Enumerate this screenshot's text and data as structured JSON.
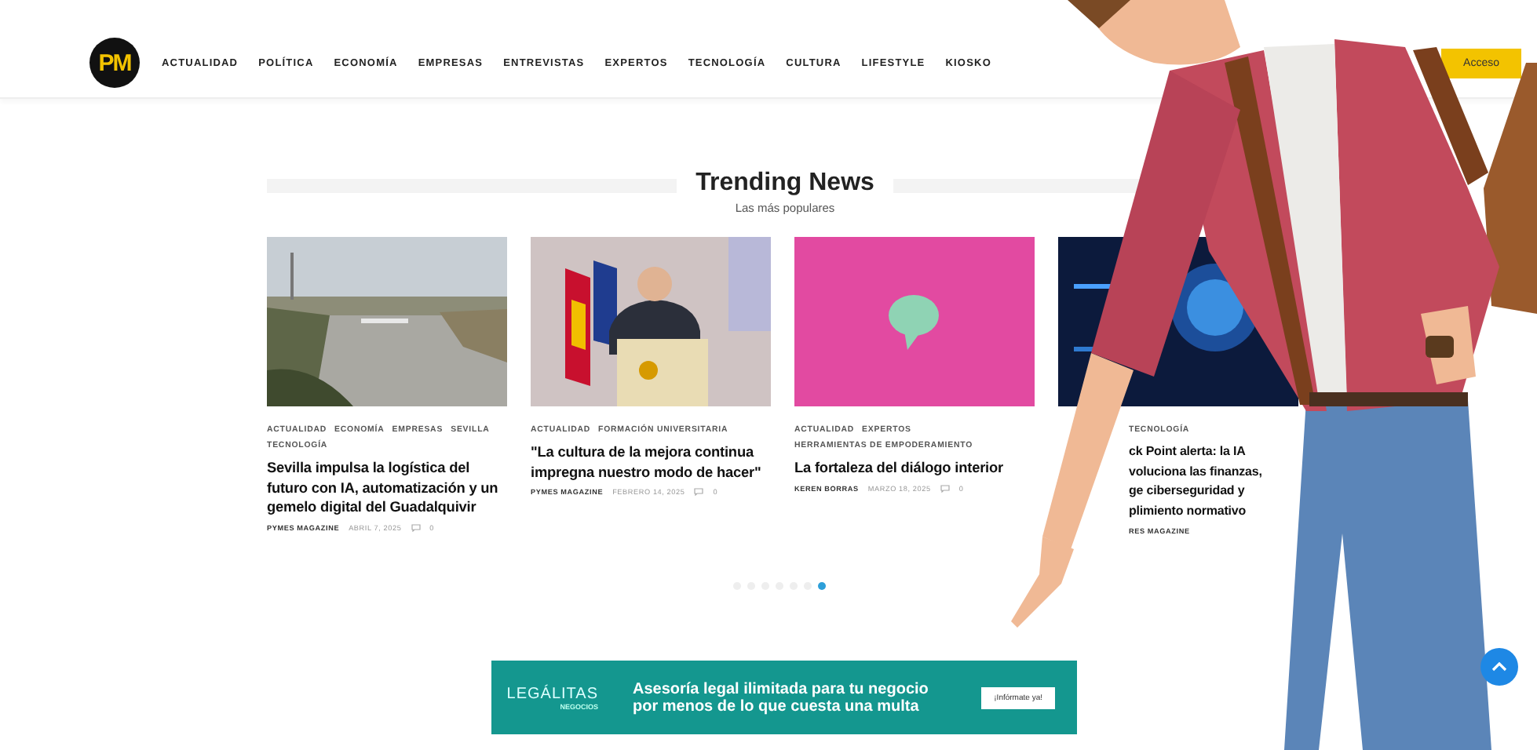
{
  "header": {
    "logo": "PM",
    "nav": [
      {
        "label": "ACTUALIDAD"
      },
      {
        "label": "POLÍTICA"
      },
      {
        "label": "ECONOMÍA"
      },
      {
        "label": "EMPRESAS"
      },
      {
        "label": "ENTREVISTAS"
      },
      {
        "label": "EXPERTOS"
      },
      {
        "label": "TECNOLOGÍA"
      },
      {
        "label": "CULTURA"
      },
      {
        "label": "LIFESTYLE"
      },
      {
        "label": "KIOSKO"
      }
    ],
    "button": "Acceso"
  },
  "section": {
    "title": "Trending News",
    "subtitle": "Las más populares"
  },
  "cards": [
    {
      "tags": [
        "ACTUALIDAD",
        "ECONOMÍA",
        "EMPRESAS",
        "SEVILLA",
        "TECNOLOGÍA"
      ],
      "title": "Sevilla impulsa la logística del futuro con IA, automatización y un gemelo digital del Guadalquivir",
      "author": "PYMES MAGAZINE",
      "date": "ABRIL 7, 2025",
      "comments": "0"
    },
    {
      "tags": [
        "ACTUALIDAD",
        "FORMACIÓN UNIVERSITARIA"
      ],
      "title": "\"La cultura de la mejora continua impregna nuestro modo de hacer\"",
      "author": "PYMES MAGAZINE",
      "date": "FEBRERO 14, 2025",
      "comments": "0"
    },
    {
      "tags": [
        "ACTUALIDAD",
        "EXPERTOS",
        "HERRAMIENTAS DE EMPODERAMIENTO"
      ],
      "title": "La fortaleza del diálogo interior",
      "author": "KEREN BORRAS",
      "date": "MARZO 18, 2025",
      "comments": "0"
    },
    {
      "tags": [
        "TECNOLOGÍA"
      ],
      "title": "ck Point alerta: la IA\nvoluciona las finanzas,\nge ciberseguridad y\nplimiento normativo",
      "author": "RES MAGAZINE"
    }
  ],
  "carousel": {
    "dots": [
      {
        "selected": false
      },
      {
        "selected": false
      },
      {
        "selected": false
      },
      {
        "selected": false
      },
      {
        "selected": false
      },
      {
        "selected": false
      },
      {
        "selected": true
      }
    ]
  },
  "ad": {
    "brand": "LEGÁLITAS",
    "brand_sub": "NEGOCIOS",
    "text": "Asesoría legal ilimitada para tu negocio por menos de lo que cuesta una multa",
    "button": "¡Infórmate ya!"
  }
}
